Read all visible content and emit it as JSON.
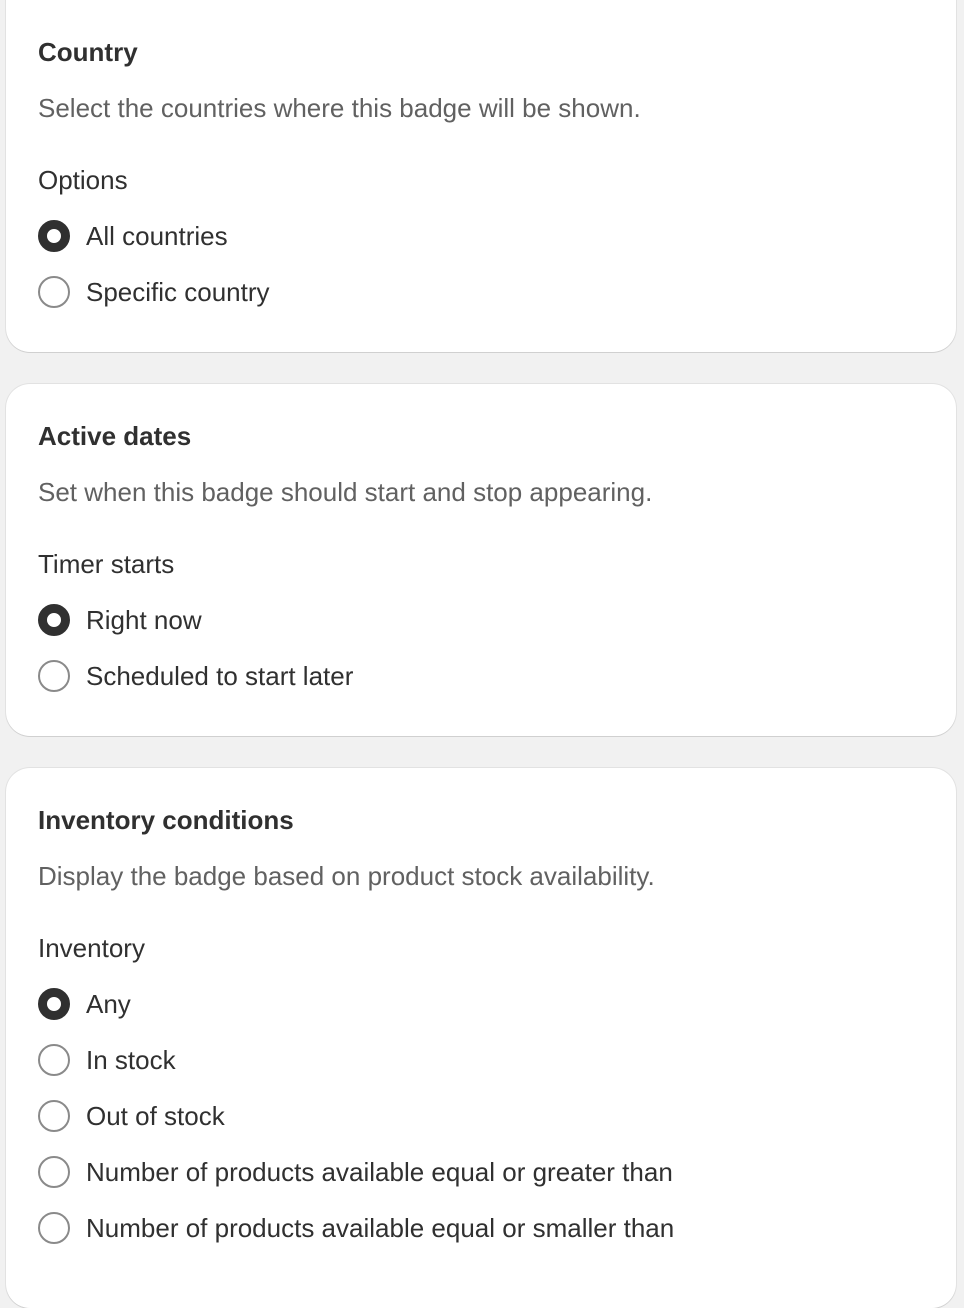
{
  "country": {
    "title": "Country",
    "description": "Select the countries where this badge will be shown.",
    "group_label": "Options",
    "options": [
      {
        "label": "All countries",
        "checked": true
      },
      {
        "label": "Specific country",
        "checked": false
      }
    ]
  },
  "active_dates": {
    "title": "Active dates",
    "description": "Set when this badge should start and stop appearing.",
    "group_label": "Timer starts",
    "options": [
      {
        "label": "Right now",
        "checked": true
      },
      {
        "label": "Scheduled to start later",
        "checked": false
      }
    ]
  },
  "inventory": {
    "title": "Inventory conditions",
    "description": "Display the badge based on product stock availability.",
    "group_label": "Inventory",
    "options": [
      {
        "label": "Any",
        "checked": true
      },
      {
        "label": "In stock",
        "checked": false
      },
      {
        "label": "Out of stock",
        "checked": false
      },
      {
        "label": "Number of products available equal or greater than",
        "checked": false
      },
      {
        "label": "Number of products available equal or smaller than",
        "checked": false
      }
    ]
  }
}
